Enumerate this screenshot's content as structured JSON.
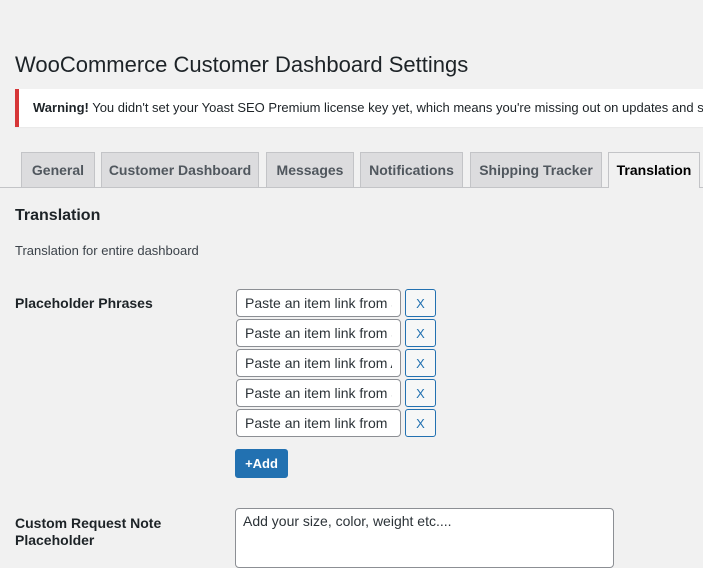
{
  "page": {
    "title": "WooCommerce Customer Dashboard Settings"
  },
  "notice": {
    "strong": "Warning!",
    "text": " You didn't set your Yoast SEO Premium license key yet, which means you're missing out on updates and support!"
  },
  "tabs": [
    {
      "label": "General",
      "active": false
    },
    {
      "label": "Customer Dashboard",
      "active": false
    },
    {
      "label": "Messages",
      "active": false
    },
    {
      "label": "Notifications",
      "active": false
    },
    {
      "label": "Shipping Tracker",
      "active": false
    },
    {
      "label": "Translation",
      "active": true
    }
  ],
  "section": {
    "title": "Translation",
    "description": "Translation for entire dashboard"
  },
  "placeholder_phrases": {
    "label": "Placeholder Phrases",
    "items": [
      "Paste an item link from amazon.com",
      "Paste an item link from aliexpress.com",
      "Paste an item link from Alibaba.com",
      "Paste an item link from any website",
      "Paste an item link from USA"
    ],
    "remove_label": "X",
    "add_label": "+Add"
  },
  "custom_request_note": {
    "label_line1": "Custom Request Note",
    "label_line2": "Placeholder",
    "value": "Add your size, color, weight etc...."
  },
  "colors": {
    "accent": "#2271b1",
    "warning_border": "#d63638",
    "background": "#f1f1f1"
  }
}
